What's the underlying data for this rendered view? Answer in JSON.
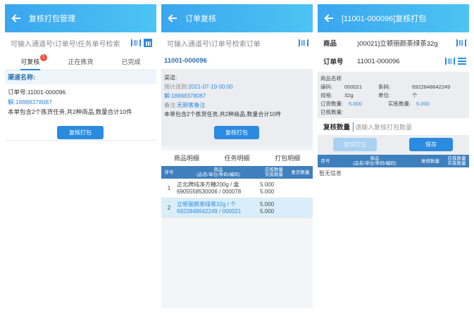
{
  "screen1": {
    "title": "复核打包管理",
    "search_placeholder": "可输入通道号\\订单号\\任务单号检索",
    "tabs": [
      {
        "label": "可复核",
        "badge": "1"
      },
      {
        "label": "正在拣货"
      },
      {
        "label": "已完成"
      }
    ],
    "card": {
      "channel_label": "渠道名称:",
      "order_no": "订单号:11001-000096",
      "phone_prefix": "解:",
      "phone": "18888378087",
      "summary": "本单包含2个拣货任务,共2种商品,数量合计10件",
      "button": "复核打包"
    }
  },
  "screen2": {
    "title": "订单复核",
    "search_placeholder": "可输入通道号\\订单号检索订单",
    "order_id": "11001-000096",
    "detail": {
      "channel": "渠道:",
      "eta_label": "预计送到:",
      "eta": "2021-07-19 00:00",
      "phone_label": "解:",
      "phone": "18888378087",
      "remark_label": "备注:",
      "remark": "无顾客备注",
      "summary": "本单包含2个拣货任务,共2种商品,数量合计10件",
      "button": "复核打包"
    },
    "tabs": [
      "商品明细",
      "任务明细",
      "打包明细"
    ],
    "table_head": {
      "col1": "序号",
      "col2a": "商品",
      "col2b": "(品名/单位/条码/编码)",
      "col3a": "应拣数量",
      "col3b": "实拣数量",
      "col4": "复货数量"
    },
    "rows": [
      {
        "no": "1",
        "line1": "正北牌纯净方糖200g / 盒",
        "line2": "6905558530006 / 000078",
        "qty1": "5.000",
        "qty2": "5.000"
      },
      {
        "no": "2",
        "line1": "立顿丽颜茶绿茶32g / 个",
        "line2": "6922848642249 / 000021",
        "qty1": "5.000",
        "qty2": "5.000"
      }
    ]
  },
  "screen3": {
    "title": "[11001-000096]复核打包",
    "product_label": "商品",
    "product_value": ")00021]立顿丽颜茶绿茶32g",
    "order_label": "订单号",
    "order_value": "11001-000096",
    "info": {
      "name_label": "商品名称",
      "code_label": "编码:",
      "code": "000021",
      "barcode_label": "条码:",
      "barcode": "6922848642249",
      "spec_label": "规格:",
      "spec": "32g",
      "unit_label": "单位:",
      "unit": "个",
      "order_qty_label": "订货数量:",
      "order_qty": "5.000",
      "picked_qty_label": "实拣数量:",
      "picked_qty": "5.000",
      "checked_label": "已核数量:"
    },
    "qty_label": "复核数量",
    "qty_placeholder": "请输入复核打包数量",
    "btn_left": "复核打包",
    "btn_save": "保存",
    "table_head": {
      "col1": "序号",
      "col2a": "商品",
      "col2b": "(品名/单位/条码/编码)",
      "col3": "复核数量",
      "col4a": "应拣数量",
      "col4b": "实拣数量"
    },
    "empty": "暂无信息"
  }
}
